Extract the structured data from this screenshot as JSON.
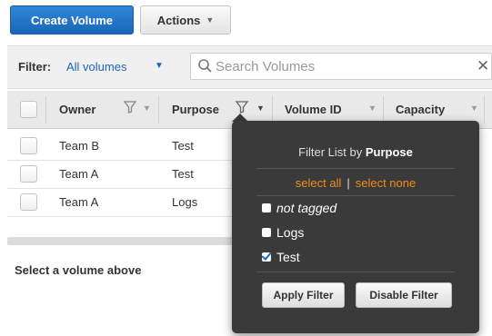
{
  "toolbar": {
    "create_label": "Create Volume",
    "actions_label": "Actions"
  },
  "filter": {
    "label": "Filter:",
    "value": "All volumes",
    "search_placeholder": "Search Volumes"
  },
  "table": {
    "columns": [
      "Owner",
      "Purpose",
      "Volume ID",
      "Capacity"
    ],
    "rows": [
      {
        "owner": "Team B",
        "purpose": "Test"
      },
      {
        "owner": "Team A",
        "purpose": "Test"
      },
      {
        "owner": "Team A",
        "purpose": "Logs"
      }
    ]
  },
  "selection_message": "Select a volume above",
  "popup": {
    "title_prefix": "Filter List by",
    "title_field": "Purpose",
    "select_all": "select all",
    "select_none": "select none",
    "options": [
      {
        "label": "not tagged",
        "checked": false,
        "italic": true
      },
      {
        "label": "Logs",
        "checked": false,
        "italic": false
      },
      {
        "label": "Test",
        "checked": true,
        "italic": false
      }
    ],
    "apply_label": "Apply Filter",
    "disable_label": "Disable Filter"
  },
  "colors": {
    "primary": "#1b66b8",
    "link_orange": "#f08c1e",
    "popup_bg": "#3a3a3a"
  }
}
